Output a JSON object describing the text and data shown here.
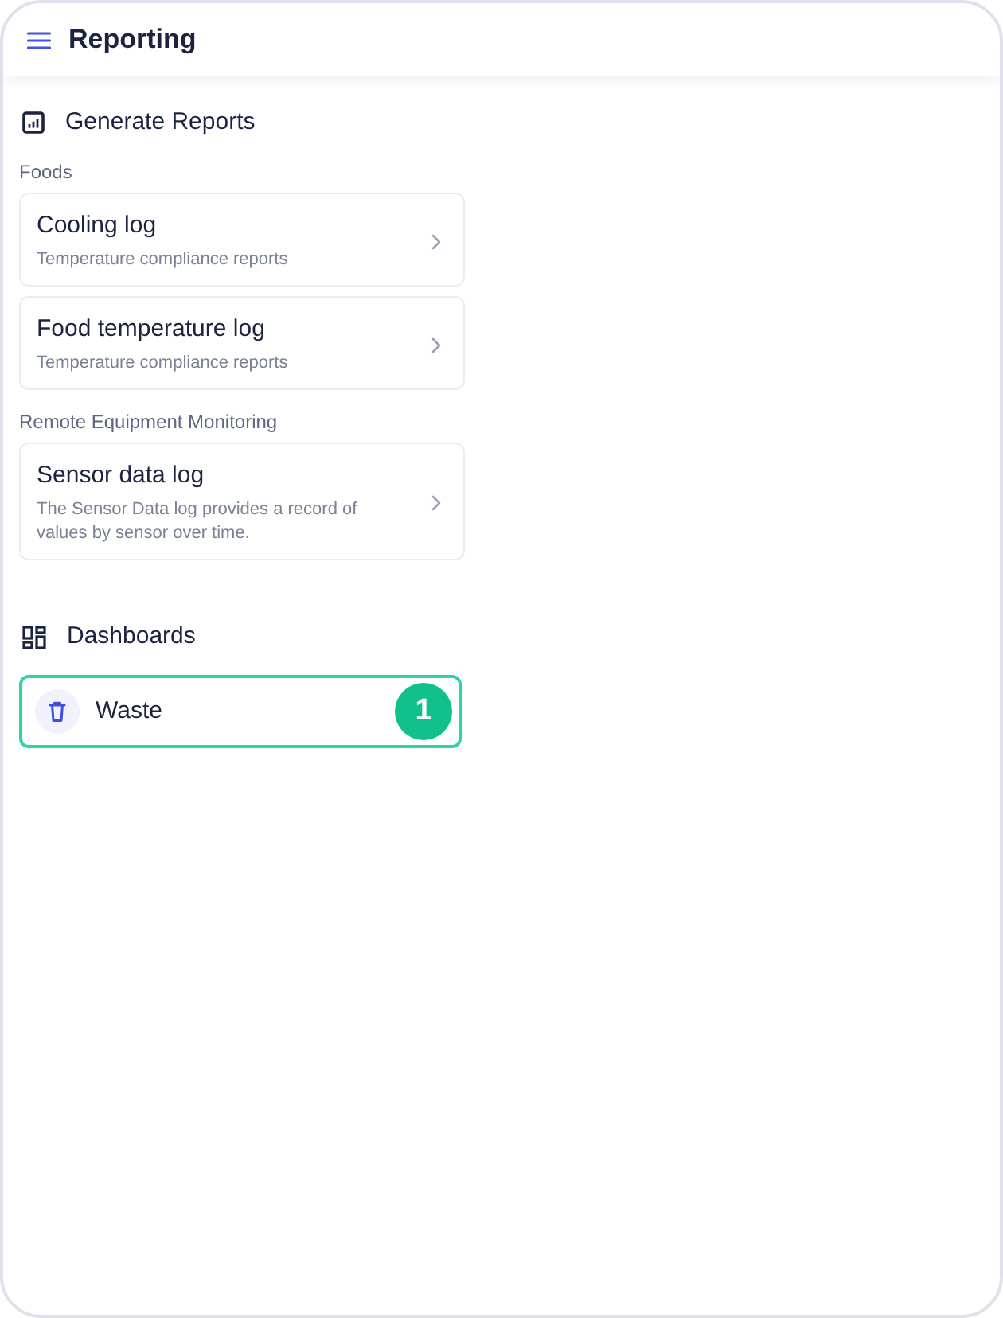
{
  "header": {
    "title": "Reporting"
  },
  "generate_reports": {
    "title": "Generate Reports",
    "groups": [
      {
        "label": "Foods",
        "items": [
          {
            "title": "Cooling log",
            "description": "Temperature compliance reports"
          },
          {
            "title": "Food temperature log",
            "description": "Temperature compliance reports"
          }
        ]
      },
      {
        "label": "Remote Equipment Monitoring",
        "items": [
          {
            "title": "Sensor data log",
            "description": "The Sensor Data log provides a record of values by sensor over time."
          }
        ]
      }
    ]
  },
  "dashboards": {
    "title": "Dashboards",
    "items": [
      {
        "title": "Waste",
        "highlighted": true,
        "badge": "1"
      }
    ]
  }
}
